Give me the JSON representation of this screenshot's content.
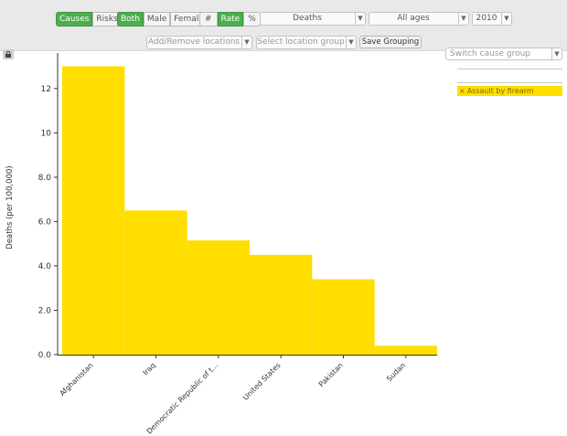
{
  "toolbar": {
    "mode_group": [
      "Causes",
      "Risks"
    ],
    "mode_active": "Causes",
    "sex_group": [
      "Both",
      "Male",
      "Female"
    ],
    "sex_active": "Both",
    "unit_group": [
      "#",
      "Rate",
      "%"
    ],
    "unit_active": "Rate",
    "measure_select": "Deaths",
    "age_select": "All ages",
    "year_select": "2010",
    "locations_select": "Add/Remove locations",
    "location_group_select": "Select location group",
    "save_button": "Save Grouping",
    "switch_cause_select": "Switch cause group"
  },
  "legend": {
    "items": [
      {
        "label": "Assault by firearm",
        "color": "#ffde00"
      }
    ]
  },
  "colors": {
    "bar": "#ffde00",
    "active_button": "#4cae4c"
  },
  "chart_data": {
    "type": "bar",
    "categories": [
      "Afghanistan",
      "Iraq",
      "Democratic Republic of t...",
      "United States",
      "Pakistan",
      "Sudan"
    ],
    "values": [
      13.0,
      6.5,
      5.15,
      4.5,
      3.4,
      0.4
    ],
    "ylabel": "Deaths (per 100,000)",
    "xlabel": "",
    "ylim": [
      0,
      13.6
    ],
    "yticks": [
      "0.0",
      "2.0",
      "4.0",
      "6.0",
      "8.0",
      "10",
      "12"
    ],
    "ytick_values": [
      0,
      2,
      4,
      6,
      8,
      10,
      12
    ],
    "grid": false,
    "legend_position": "top-right"
  }
}
